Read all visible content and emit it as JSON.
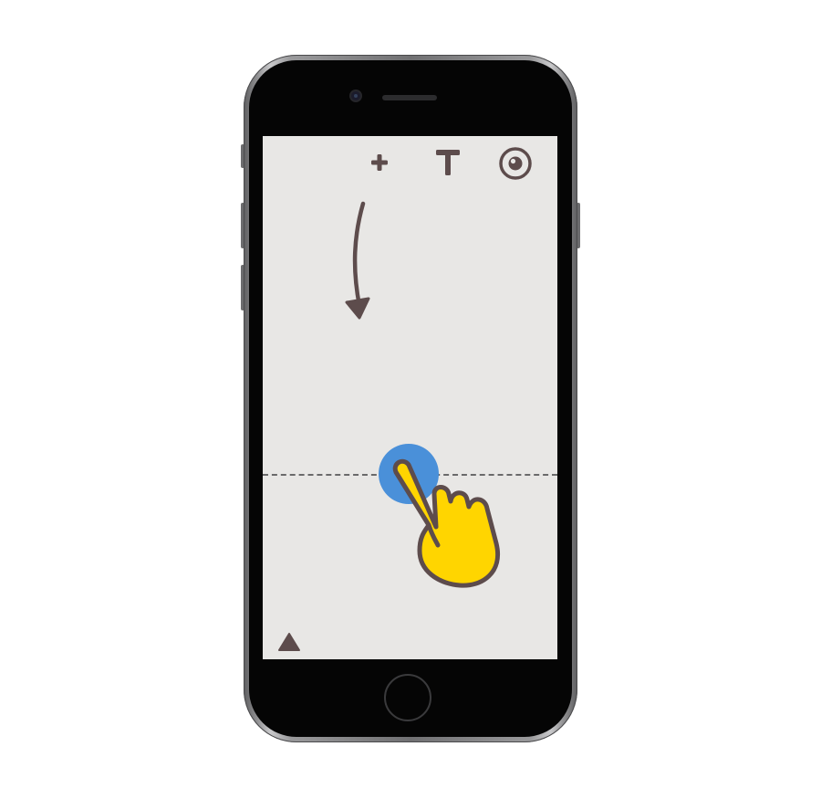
{
  "screenshot": {
    "device": "iPhone",
    "screen_background": "#e8e7e5",
    "icon_color": "#5d4c4c",
    "touch_color": "#4a90d9",
    "hand_color": "#ffd500"
  },
  "toolbar": {
    "add_icon": "plus-icon",
    "text_icon": "text-tool-icon",
    "view_icon": "eye-icon"
  },
  "canvas": {
    "gesture_hint": "swipe-down-arrow-icon",
    "guide": "dashed-divider",
    "touch_indicator": "tap-point",
    "hand": "pointing-hand-icon"
  },
  "bottom": {
    "menu_icon": "triangle-up-icon"
  }
}
